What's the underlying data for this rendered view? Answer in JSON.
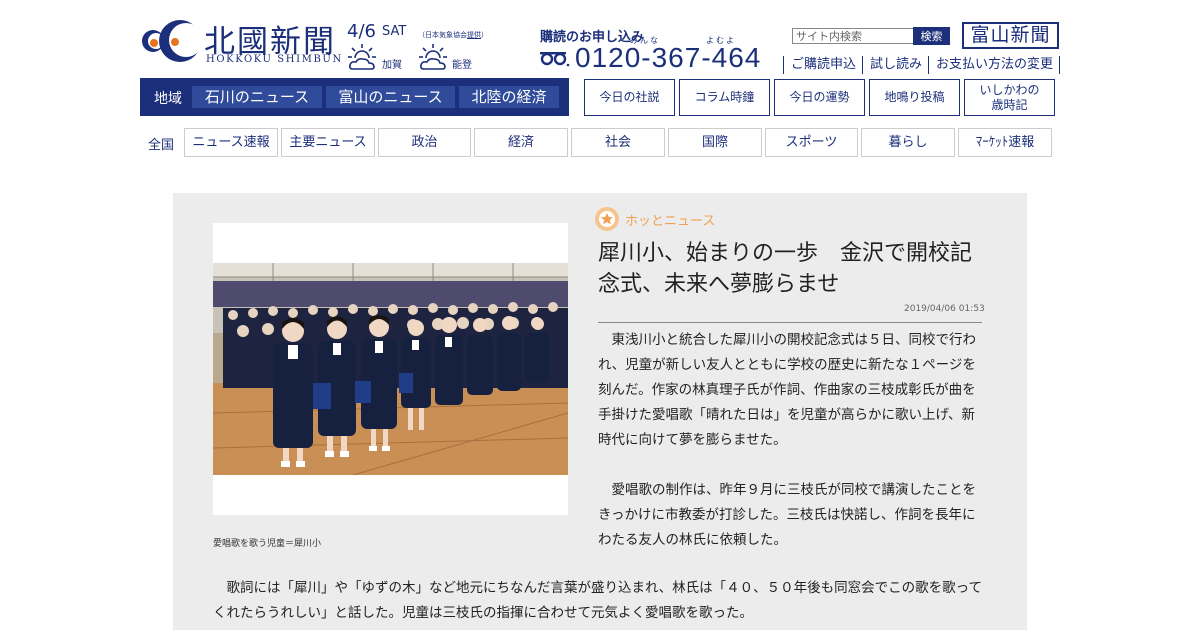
{
  "colors": {
    "brand_navy": "#1c2f7a",
    "region_item": "#2f4b9a",
    "tag_orange": "#f0a050",
    "article_bg": "#ececec"
  },
  "header": {
    "logo_title": "北國新聞",
    "logo_roman": "HOKKOKU SHIMBUN",
    "date": "4/6",
    "day_of_week": "SAT",
    "weather_credit": "（日本気象協会",
    "weather_credit_link": "提供",
    "weather_credit_end": "）",
    "weather": [
      {
        "area": "加賀",
        "icon": "cloudy-sun-icon"
      },
      {
        "area": "能登",
        "icon": "cloudy-sun-icon"
      }
    ],
    "subscribe_title": "購読のお申し込み",
    "phone_ruby": [
      "みんな",
      "よむよ"
    ],
    "phone_number": "0120-367-464",
    "search_placeholder": "サイト内検索",
    "search_button": "検索",
    "toyama_link": "富山新聞",
    "sublinks": [
      "ご購読申込",
      "試し読み",
      "お支払い方法の変更"
    ]
  },
  "region_nav": {
    "label": "地域",
    "items": [
      "石川のニュース",
      "富山のニュース",
      "北陸の経済"
    ]
  },
  "tool_buttons": [
    "今日の社説",
    "コラム時鐘",
    "今日の運勢",
    "地鳴り投稿",
    "いしかわの\n歳時記"
  ],
  "category_nav": {
    "label": "全国",
    "items": [
      "ニュース速報",
      "主要ニュース",
      "政治",
      "経済",
      "社会",
      "国際",
      "スポーツ",
      "暮らし",
      "ﾏｰｹｯﾄ速報"
    ]
  },
  "article": {
    "tag": "ホッとニュース",
    "headline": "犀川小、始まりの一歩　金沢で開校記念式、未来へ夢膨らませ",
    "timestamp": "2019/04/06 01:53",
    "photo_caption": "愛唱歌を歌う児童＝犀川小",
    "paragraphs_side": [
      "東浅川小と統合した犀川小の開校記念式は５日、同校で行われ、児童が新しい友人とともに学校の歴史に新たな１ページを刻んだ。作家の林真理子氏が作詞、作曲家の三枝成彰氏が曲を手掛けた愛唱歌「晴れた日は」を児童が高らかに歌い上げ、新時代に向けて夢を膨らませた。",
      "愛唱歌の制作は、昨年９月に三枝氏が同校で講演したことをきっかけに市教委が打診した。三枝氏は快諾し、作詞を長年にわたる友人の林氏に依頼した。"
    ],
    "paragraph_full": "歌詞には「犀川」や「ゆずの木」など地元にちなんだ言葉が盛り込まれ、林氏は「４０、５０年後も同窓会でこの歌を歌ってくれたらうれしい」と話した。児童は三枝氏の指揮に合わせて元気よく愛唱歌を歌った。"
  }
}
